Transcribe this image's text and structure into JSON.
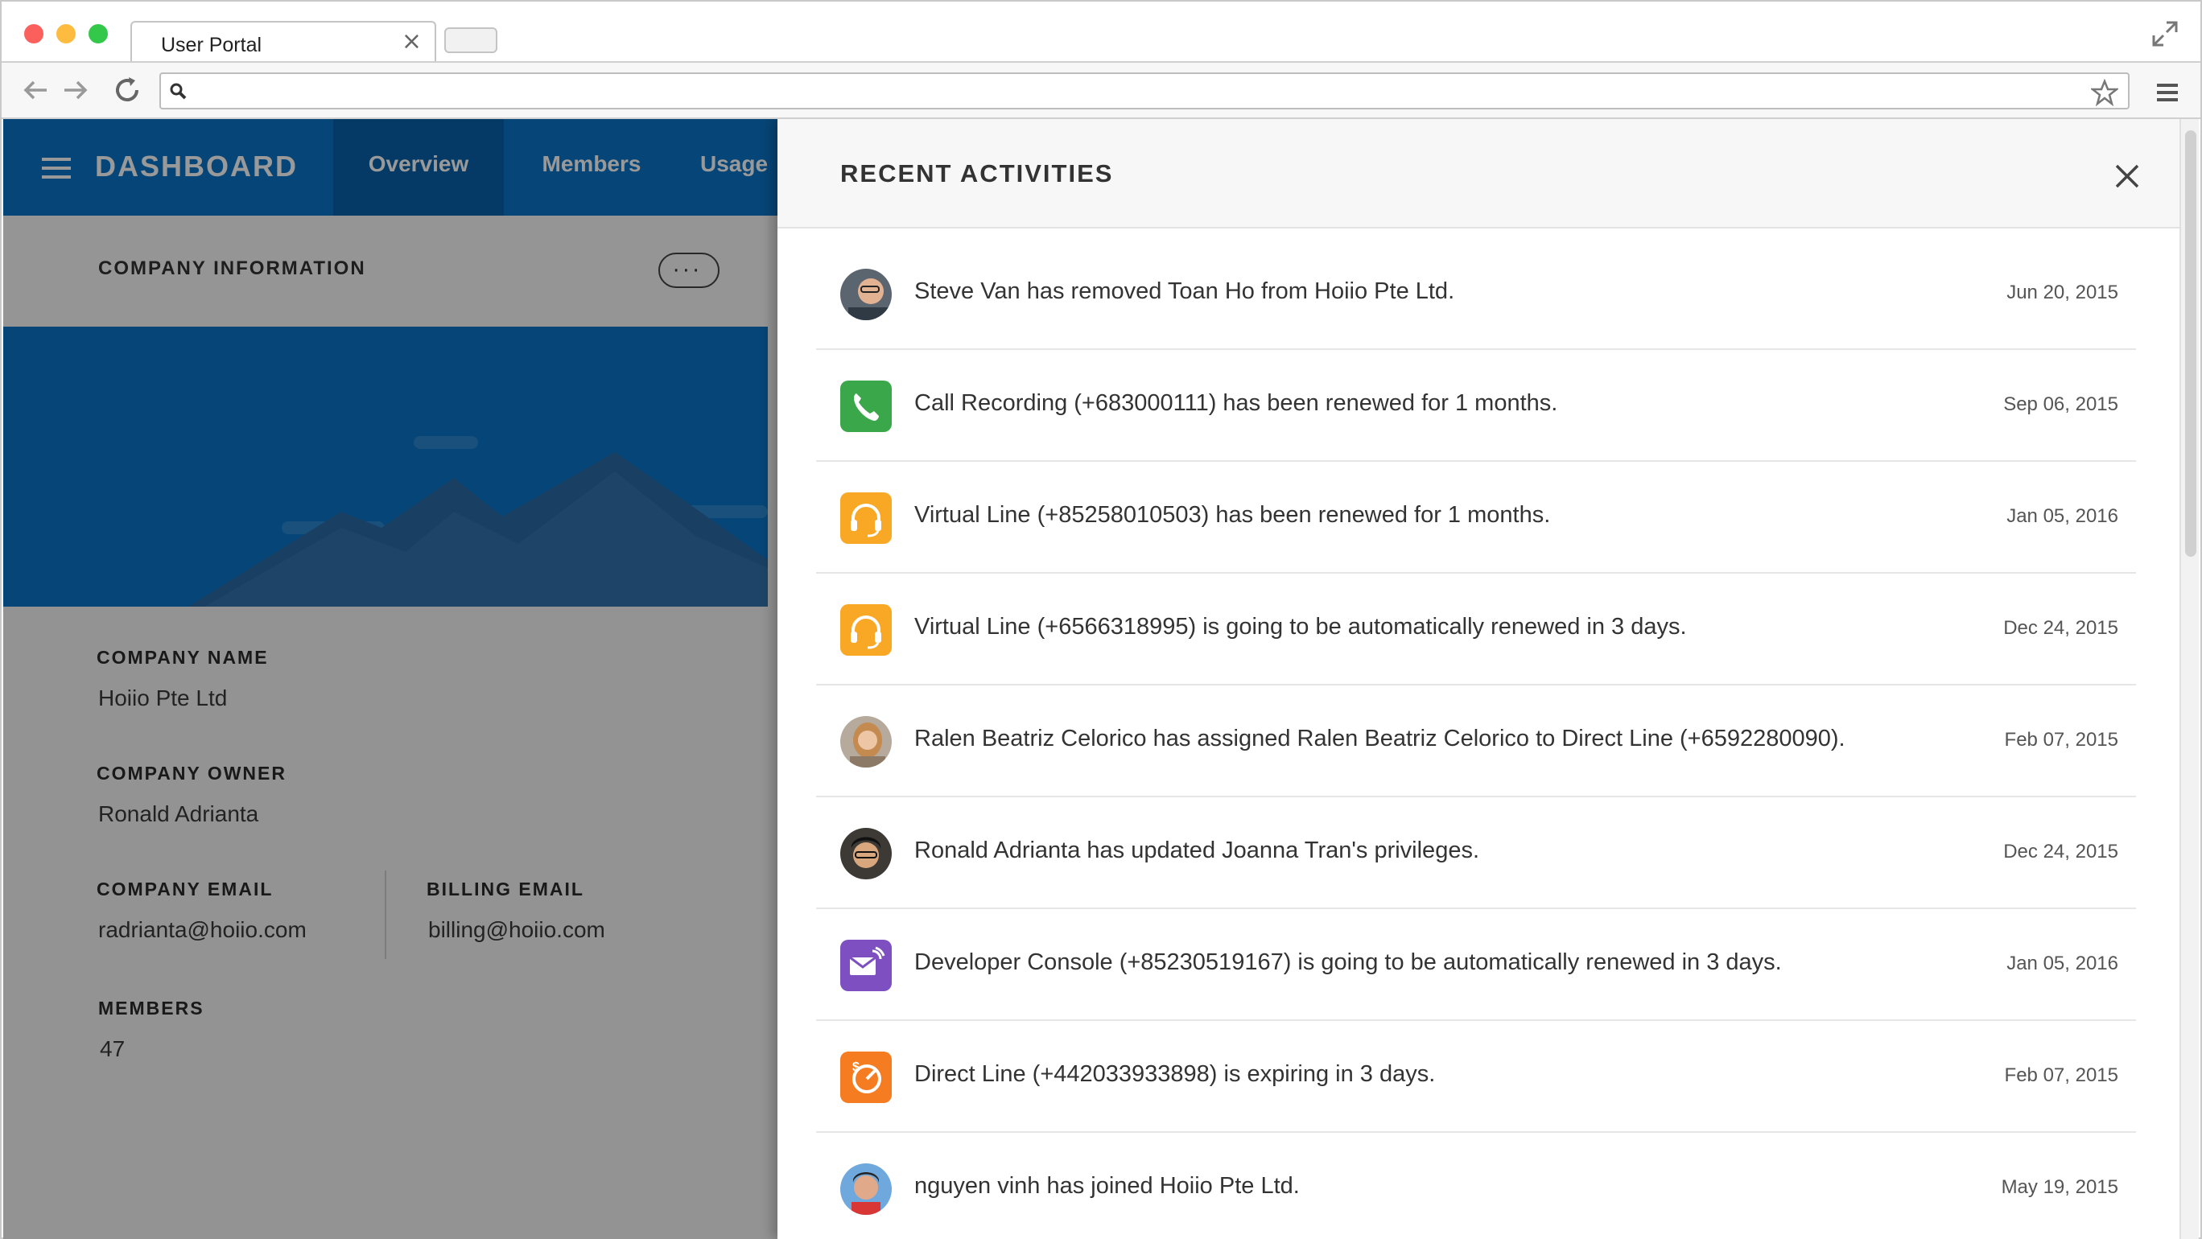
{
  "browser": {
    "tab_title": "User Portal",
    "tab_close": "×",
    "url_value": ""
  },
  "app": {
    "brand": "DASHBOARD",
    "nav_tabs": [
      {
        "label": "Overview",
        "active": true
      },
      {
        "label": "Members",
        "active": false
      },
      {
        "label": "Usage",
        "active": false
      }
    ],
    "company_info": {
      "section_title": "COMPANY INFORMATION",
      "more_label": "···",
      "company_name_label": "COMPANY NAME",
      "company_name": "Hoiio Pte Ltd",
      "company_owner_label": "COMPANY OWNER",
      "company_owner": "Ronald Adrianta",
      "company_email_label": "COMPANY EMAIL",
      "company_email": "radrianta@hoiio.com",
      "billing_email_label": "BILLING EMAIL",
      "billing_email": "billing@hoiio.com",
      "members_label": "MEMBERS",
      "members": "47"
    }
  },
  "panel": {
    "title": "RECENT ACTIVITIES",
    "activities": [
      {
        "icon": "avatar-steve-van",
        "text": "Steve Van has removed Toan Ho from Hoiio Pte Ltd.",
        "date": "Jun 20, 2015"
      },
      {
        "icon": "call-recording-icon",
        "text": "Call Recording (+683000111) has been renewed for 1 months.",
        "date": "Sep 06, 2015"
      },
      {
        "icon": "virtual-line-icon",
        "text": "Virtual Line (+85258010503) has been renewed for 1 months.",
        "date": "Jan 05, 2016"
      },
      {
        "icon": "virtual-line-icon",
        "text": "Virtual Line (+6566318995) is going to be automatically renewed in 3 days.",
        "date": "Dec 24, 2015"
      },
      {
        "icon": "avatar-ralen",
        "text": "Ralen Beatriz Celorico has assigned Ralen Beatriz Celorico to Direct Line (+6592280090).",
        "date": "Feb 07, 2015"
      },
      {
        "icon": "avatar-ronald",
        "text": "Ronald Adrianta has updated Joanna Tran's privileges.",
        "date": "Dec 24, 2015"
      },
      {
        "icon": "developer-console-icon",
        "text": "Developer Console (+85230519167) is going to be automatically renewed in 3 days.",
        "date": "Jan 05, 2016"
      },
      {
        "icon": "direct-line-icon",
        "text": "Direct Line (+442033933898) is expiring in 3 days.",
        "date": "Feb 07, 2015"
      },
      {
        "icon": "avatar-nguyen",
        "text": "nguyen vinh has joined Hoiio Pte Ltd.",
        "date": "May 19, 2015"
      }
    ]
  },
  "colors": {
    "brand_blue": "#0a74c6",
    "brand_blue_dark": "#0862a8",
    "call_green": "#3aa84a",
    "virtual_orange": "#f9a825",
    "developer_purple": "#7e4fc0",
    "direct_orange": "#f57c21"
  }
}
